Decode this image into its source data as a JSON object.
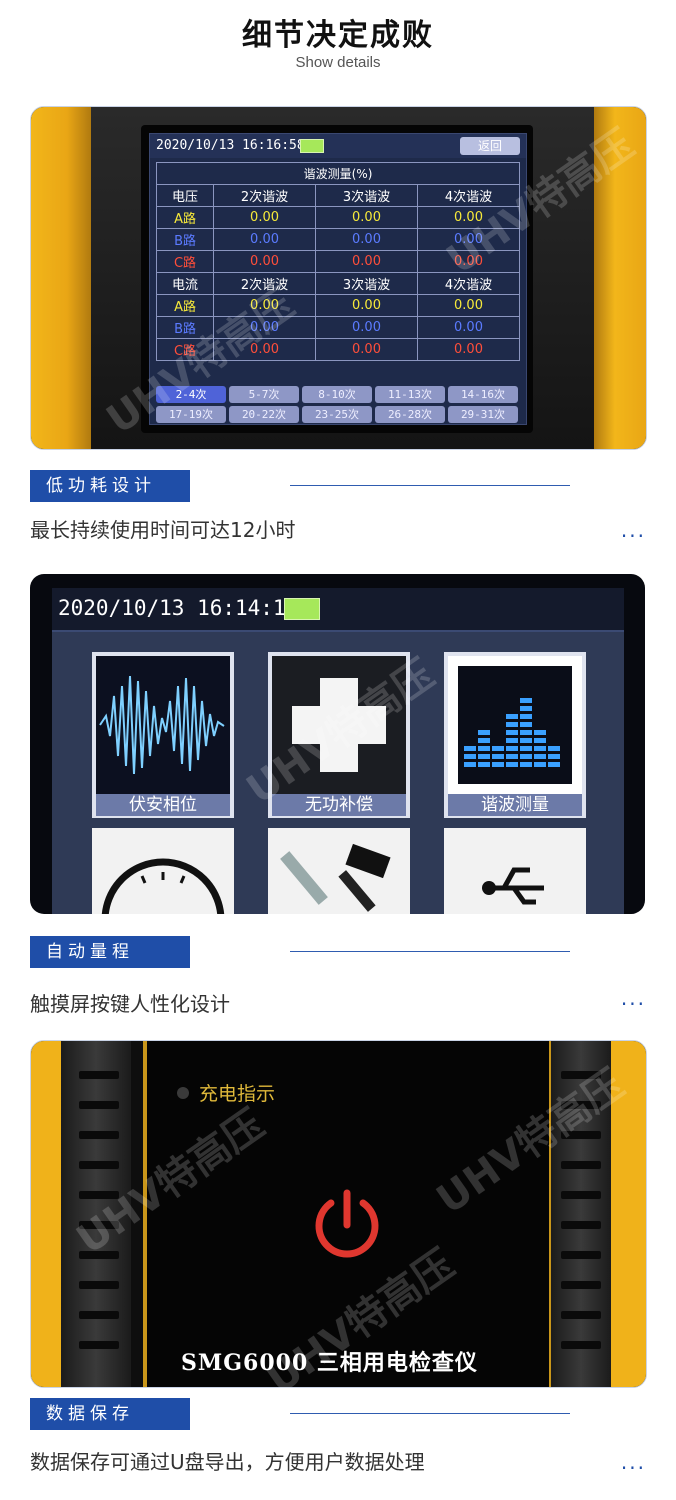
{
  "header": {
    "title": "细节决定成败",
    "subtitle": "Show details"
  },
  "photo1": {
    "datetime": "2020/10/13 16:16:58",
    "back_label": "返回",
    "table_title": "谐波测量(%)",
    "voltage_header": [
      "电压",
      "2次谐波",
      "3次谐波",
      "4次谐波"
    ],
    "current_header": [
      "电流",
      "2次谐波",
      "3次谐波",
      "4次谐波"
    ],
    "rows": [
      {
        "phase": "A路",
        "values": [
          "0.00",
          "0.00",
          "0.00"
        ]
      },
      {
        "phase": "B路",
        "values": [
          "0.00",
          "0.00",
          "0.00"
        ]
      },
      {
        "phase": "C路",
        "values": [
          "0.00",
          "0.00",
          "0.00"
        ]
      }
    ],
    "tabs": [
      "2-4次",
      "5-7次",
      "8-10次",
      "11-13次",
      "14-16次",
      "17-19次",
      "20-22次",
      "23-25次",
      "26-28次",
      "29-31次"
    ]
  },
  "section1": {
    "label": "低功耗设计",
    "description": "最长持续使用时间可达12小时",
    "dots": "..."
  },
  "photo2": {
    "datetime": "2020/10/13 16:14:18",
    "tiles": [
      "伏安相位",
      "无功补偿",
      "谐波测量"
    ]
  },
  "section2": {
    "label": "自动量程",
    "description": "触摸屏按键人性化设计",
    "dots": "..."
  },
  "photo3": {
    "charge_label": "充电指示",
    "model": "SMG6000 三相用电检查仪"
  },
  "section3": {
    "label": "数据保存",
    "description": "数据保存可通过U盘导出，方便用户数据处理",
    "dots": "..."
  },
  "watermark": "UHV特高压",
  "colors": {
    "accent": "#1f4ea8",
    "device_yellow": "#f0b21a",
    "lcd_bg": "#1e2a4a"
  }
}
